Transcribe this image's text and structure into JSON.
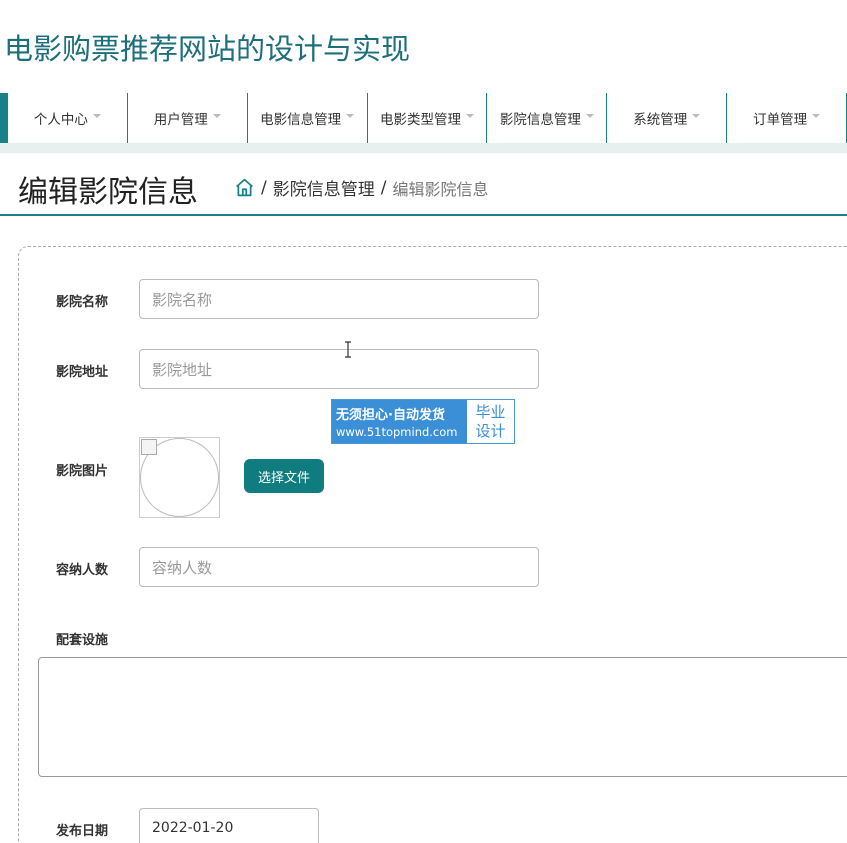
{
  "site": {
    "title": "电影购票推荐网站的设计与实现"
  },
  "nav": {
    "items": [
      {
        "label": "个人中心"
      },
      {
        "label": "用户管理"
      },
      {
        "label": "电影信息管理"
      },
      {
        "label": "电影类型管理"
      },
      {
        "label": "影院信息管理"
      },
      {
        "label": "系统管理"
      },
      {
        "label": "订单管理"
      }
    ]
  },
  "page": {
    "title": "编辑影院信息"
  },
  "breadcrumb": {
    "section": "影院信息管理",
    "current": "编辑影院信息",
    "separator": "/",
    "home_icon": "home-icon"
  },
  "form": {
    "name": {
      "label": "影院名称",
      "placeholder": "影院名称",
      "value": ""
    },
    "address": {
      "label": "影院地址",
      "placeholder": "影院地址",
      "value": ""
    },
    "image": {
      "label": "影院图片",
      "button": "选择文件"
    },
    "capacity": {
      "label": "容纳人数",
      "placeholder": "容纳人数",
      "value": ""
    },
    "facilities": {
      "label": "配套设施",
      "value": ""
    },
    "publish_date": {
      "label": "发布日期",
      "value": "2022-01-20"
    }
  },
  "watermark": {
    "line1": "无须担心·自动发货",
    "line2": "www.51topmind.com",
    "badge1": "毕业",
    "badge2": "设计"
  },
  "colors": {
    "accent": "#17818a",
    "title": "#1e6f7c",
    "button": "#0f7c80",
    "watermark": "#3a8fd6"
  }
}
